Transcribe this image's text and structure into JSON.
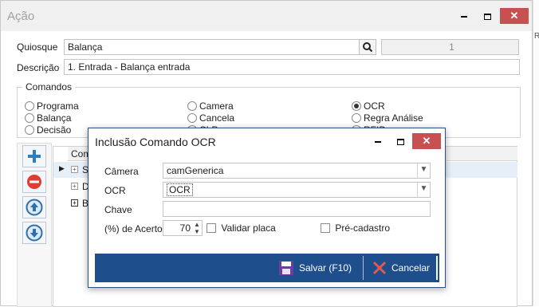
{
  "window": {
    "title": "Ação",
    "right_label": "R"
  },
  "form": {
    "quiosque_label": "Quiosque",
    "quiosque_value": "Balança",
    "quiosque_id": "1",
    "descricao_label": "Descrição",
    "descricao_value": "1. Entrada - Balança entrada"
  },
  "comandos": {
    "legend": "Comandos",
    "options": [
      {
        "label": "Programa",
        "checked": false
      },
      {
        "label": "Camera",
        "checked": false
      },
      {
        "label": "OCR",
        "checked": true
      },
      {
        "label": "Balança",
        "checked": false
      },
      {
        "label": "Cancela",
        "checked": false
      },
      {
        "label": "Regra Análise",
        "checked": false
      },
      {
        "label": "Decisão",
        "checked": false
      },
      {
        "label": "CLP",
        "checked": false
      },
      {
        "label": "RFID",
        "checked": false
      }
    ]
  },
  "grid": {
    "header": "Coma",
    "rows": [
      {
        "text": "SE"
      },
      {
        "text": "DA"
      },
      {
        "text": "Ba"
      }
    ]
  },
  "dialog": {
    "title": "Inclusão Comando OCR",
    "camera_label": "Câmera",
    "camera_value": "camGenerica",
    "ocr_label": "OCR",
    "ocr_value": "OCR",
    "chave_label": "Chave",
    "chave_value": "",
    "acerto_label": "(%) de Acerto",
    "acerto_value": "70",
    "validar_label": "Validar placa",
    "precadastro_label": "Pré-cadastro",
    "salvar_label": "Salvar (F10)",
    "cancelar_label": "Cancelar"
  },
  "colors": {
    "accent": "#1f4e8c",
    "close": "#c75050",
    "cancel_icon": "#d9534f",
    "add_icon": "#2f7ec1",
    "remove_icon": "#e03c31"
  }
}
